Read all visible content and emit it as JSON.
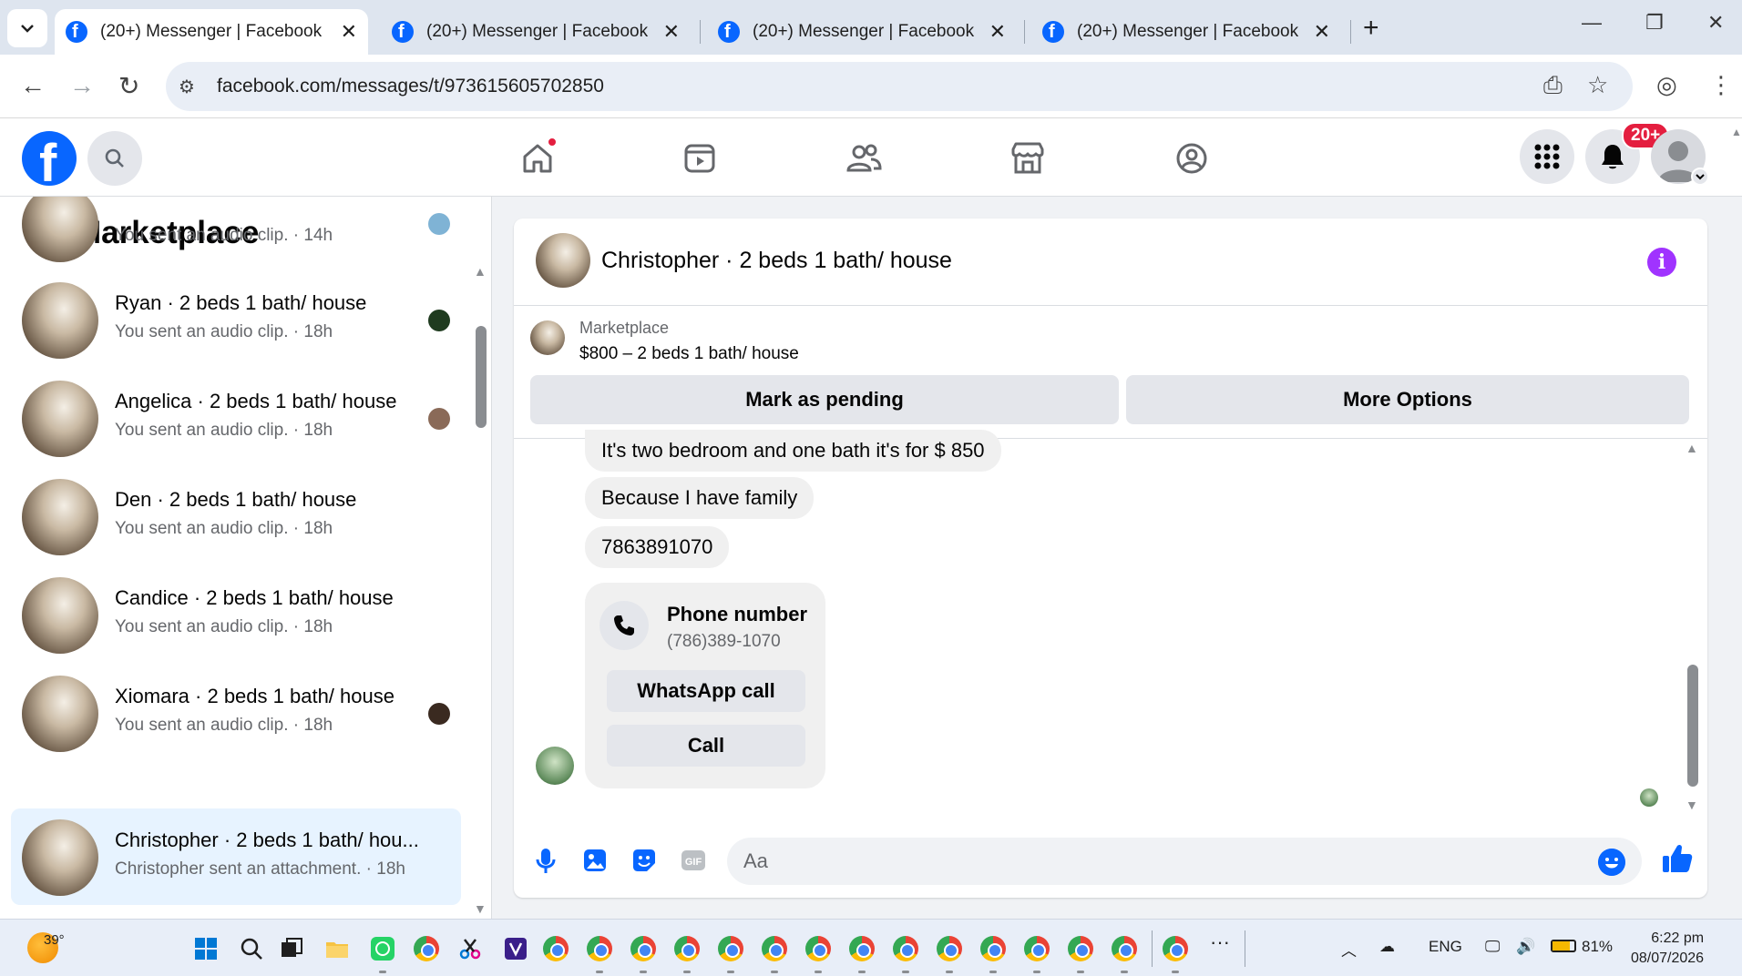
{
  "browser": {
    "tabs": [
      {
        "title": "(20+) Messenger | Facebook",
        "active": true
      },
      {
        "title": "(20+) Messenger | Facebook",
        "active": false
      },
      {
        "title": "(20+) Messenger | Facebook",
        "active": false
      },
      {
        "title": "(20+) Messenger | Facebook",
        "active": false
      }
    ],
    "url": "facebook.com/messages/t/973615605702850"
  },
  "fb_nav": {
    "notifications_badge": "20+"
  },
  "sidebar": {
    "title": "Marketplace",
    "conversations": [
      {
        "title": "",
        "subtitle": "You sent an audio clip. · 14h",
        "avatar_color": "#7fb3d5"
      },
      {
        "title": "Ryan · 2 beds 1 bath/ house",
        "subtitle": "You sent an audio clip. · 18h",
        "avatar_color": "#1f3b1f"
      },
      {
        "title": "Angelica · 2 beds 1 bath/ house",
        "subtitle": "You sent an audio clip. · 18h",
        "avatar_color": "#8a6a58"
      },
      {
        "title": "Den · 2 beds 1 bath/ house",
        "subtitle": "You sent an audio clip. · 18h",
        "avatar_color": ""
      },
      {
        "title": "Candice · 2 beds 1 bath/ house",
        "subtitle": "You sent an audio clip. · 18h",
        "avatar_color": ""
      },
      {
        "title": "Xiomara · 2 beds 1 bath/ house",
        "subtitle": "You sent an audio clip. · 18h",
        "avatar_color": "#3a2a20"
      },
      {
        "title": "Christopher · 2 beds 1 bath/ hou...",
        "subtitle": "Christopher sent an attachment. · 18h",
        "avatar_color": "",
        "selected": true
      }
    ]
  },
  "chat": {
    "title": "Christopher · 2 beds 1 bath/ house",
    "listing": {
      "label": "Marketplace",
      "price_title": "$800 – 2 beds 1 bath/ house",
      "mark_pending": "Mark as pending",
      "more_options": "More Options"
    },
    "messages": [
      "It's two bedroom and one bath it's for $ 850",
      "Because I have family",
      "7863891070"
    ],
    "phone_card": {
      "title": "Phone number",
      "number": "(786)389-1070",
      "whatsapp_label": "WhatsApp call",
      "call_label": "Call"
    },
    "composer_placeholder": "Aa"
  },
  "taskbar": {
    "weather_temp": "39°",
    "language": "ENG",
    "battery": "81%",
    "time": "6:22 pm",
    "date": "08/07/2026"
  },
  "colors": {
    "fb_blue": "#0866ff",
    "selected_row": "#e7f3ff",
    "info_purple": "#a033ff",
    "badge_red": "#e41e3f"
  }
}
